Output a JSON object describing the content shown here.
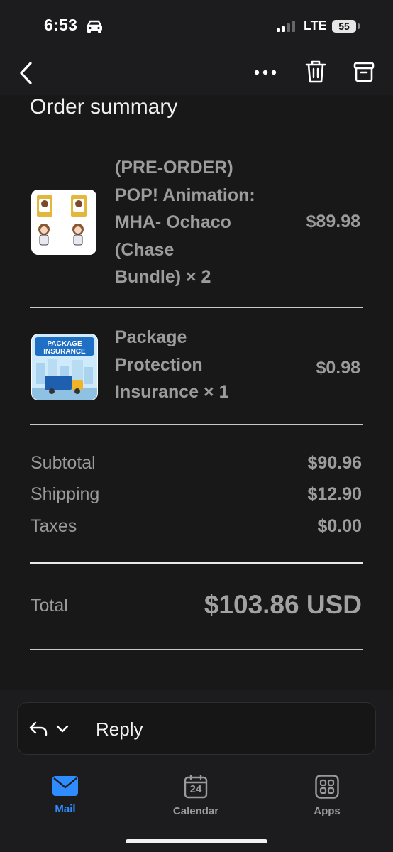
{
  "status_bar": {
    "time": "6:53",
    "network": "LTE",
    "battery": "55",
    "icons": [
      "car-icon",
      "signal-icon"
    ]
  },
  "toolbar": {
    "icons": [
      "back-icon",
      "more-icon",
      "trash-icon",
      "archive-icon"
    ]
  },
  "order_summary": {
    "title": "Order summary",
    "items": [
      {
        "name_lines": [
          "(PRE-ORDER)",
          "POP! Animation:",
          "MHA- Ochaco",
          "(Chase",
          "Bundle) × 2"
        ],
        "price": "$89.98"
      },
      {
        "name_lines": [
          "Package",
          "Protection",
          "Insurance × 1"
        ],
        "price": "$0.98",
        "thumb_text": [
          "PACKAGE",
          "INSURANCE"
        ]
      }
    ],
    "totals": [
      {
        "label": "Subtotal",
        "value": "$90.96"
      },
      {
        "label": "Shipping",
        "value": "$12.90"
      },
      {
        "label": "Taxes",
        "value": "$0.00"
      }
    ],
    "total": {
      "label": "Total",
      "value": "$103.86 USD"
    }
  },
  "reply": {
    "label": "Reply"
  },
  "tab_bar": {
    "tabs": [
      {
        "label": "Mail",
        "icon": "mail-icon",
        "active": true
      },
      {
        "label": "Calendar",
        "icon": "calendar-icon",
        "badge": "24"
      },
      {
        "label": "Apps",
        "icon": "apps-icon"
      }
    ]
  },
  "colors": {
    "accent": "#2f8cff",
    "background": "#181818",
    "bar": "#1c1c1e",
    "muted_text": "#9c9c9c"
  }
}
